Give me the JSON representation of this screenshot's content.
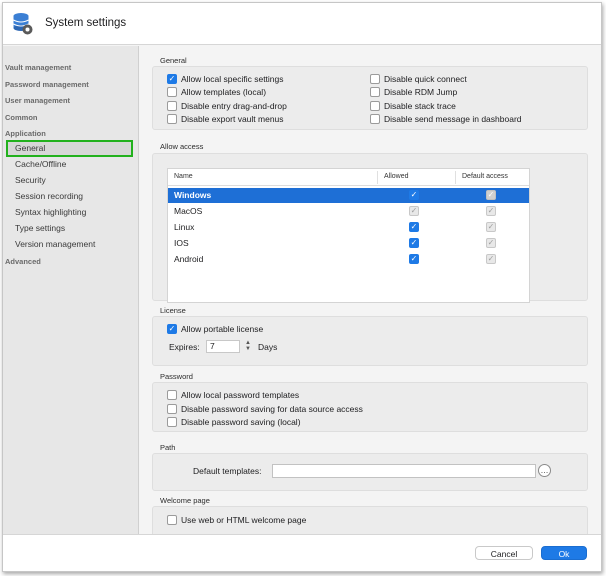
{
  "window": {
    "title": "System settings",
    "app_icon": "database-gear-icon"
  },
  "sidebar": {
    "groups": [
      {
        "label": "Vault management"
      },
      {
        "label": "Password management"
      },
      {
        "label": "User management"
      },
      {
        "label": "Common"
      },
      {
        "label": "Application"
      }
    ],
    "application_items": [
      {
        "label": "General",
        "selected": true
      },
      {
        "label": "Cache/Offline"
      },
      {
        "label": "Security"
      },
      {
        "label": "Session recording"
      },
      {
        "label": "Syntax highlighting"
      },
      {
        "label": "Type settings"
      },
      {
        "label": "Version management"
      }
    ],
    "advanced": {
      "label": "Advanced"
    },
    "selection_color": "#22b11d"
  },
  "general": {
    "title": "General",
    "left": [
      {
        "label": "Allow local specific settings",
        "checked": true
      },
      {
        "label": "Allow templates (local)",
        "checked": false
      },
      {
        "label": "Disable entry drag-and-drop",
        "checked": false
      },
      {
        "label": "Disable export vault menus",
        "checked": false
      }
    ],
    "right": [
      {
        "label": "Disable quick connect",
        "checked": false
      },
      {
        "label": "Disable RDM Jump",
        "checked": false
      },
      {
        "label": "Disable stack trace",
        "checked": false
      },
      {
        "label": "Disable send message in dashboard",
        "checked": false
      }
    ]
  },
  "allow_access": {
    "title": "Allow access",
    "columns": {
      "name": "Name",
      "allowed": "Allowed",
      "default_access": "Default access"
    },
    "rows": [
      {
        "name": "Windows",
        "allowed": true,
        "allowed_enabled": true,
        "default": true,
        "selected": true
      },
      {
        "name": "MacOS",
        "allowed": true,
        "allowed_enabled": false,
        "default": true
      },
      {
        "name": "Linux",
        "allowed": true,
        "allowed_enabled": true,
        "default": true
      },
      {
        "name": "IOS",
        "allowed": true,
        "allowed_enabled": true,
        "default": true
      },
      {
        "name": "Android",
        "allowed": true,
        "allowed_enabled": true,
        "default": true
      }
    ]
  },
  "license": {
    "title": "License",
    "allow_portable": {
      "label": "Allow portable license",
      "checked": true
    },
    "expires_label": "Expires:",
    "expires_value": "7",
    "days_label": "Days"
  },
  "password": {
    "title": "Password",
    "items": [
      {
        "label": "Allow local password templates",
        "checked": false
      },
      {
        "label": "Disable password saving for data source access",
        "checked": false
      },
      {
        "label": "Disable password saving (local)",
        "checked": false
      }
    ]
  },
  "path": {
    "title": "Path",
    "default_templates_label": "Default templates:",
    "default_templates_value": ""
  },
  "welcome": {
    "title": "Welcome page",
    "use_web": {
      "label": "Use web or HTML welcome page",
      "checked": false
    }
  },
  "footer": {
    "cancel_label": "Cancel",
    "ok_label": "Ok"
  },
  "colors": {
    "accent": "#1e7ae6",
    "selection": "#1e6fd6"
  }
}
